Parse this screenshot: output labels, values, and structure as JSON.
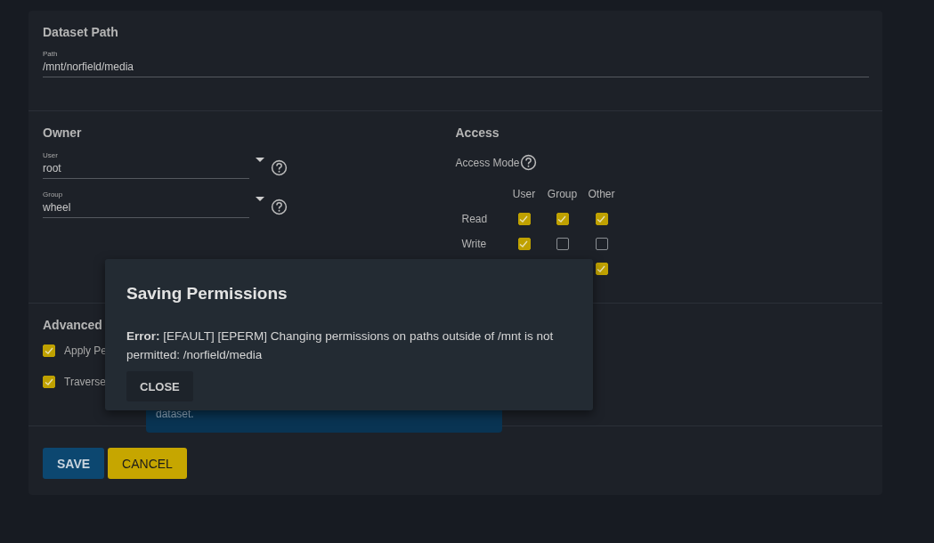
{
  "dataset_path": {
    "title": "Dataset Path",
    "path_field": {
      "label": "Path",
      "value": "/mnt/norfield/media"
    }
  },
  "owner": {
    "title": "Owner",
    "fields": [
      {
        "label": "User",
        "value": "root"
      },
      {
        "label": "Group",
        "value": "wheel"
      }
    ]
  },
  "access": {
    "title": "Access",
    "mode_label": "Access Mode",
    "columns": [
      "User",
      "Group",
      "Other"
    ],
    "rows": [
      {
        "label": "Read",
        "user": true,
        "group": true,
        "other": true
      },
      {
        "label": "Write",
        "user": true,
        "group": false,
        "other": false
      },
      {
        "other": true
      }
    ]
  },
  "advanced": {
    "title": "Advanced",
    "options": [
      {
        "label": "Apply Pe",
        "checked": true
      },
      {
        "label": "Traverse",
        "checked": true
      }
    ]
  },
  "tooltip": {
    "text": "dataset."
  },
  "buttons": [
    {
      "label": "SAVE",
      "kind": "primary"
    },
    {
      "label": "CANCEL",
      "kind": "secondary"
    }
  ],
  "dialog": {
    "title": "Saving Permissions",
    "message": "**Error:** [EFAULT] [EPERM] Changing permissions on paths outside of /mnt is not permitted: /norfield/media",
    "button": "CLOSE"
  }
}
